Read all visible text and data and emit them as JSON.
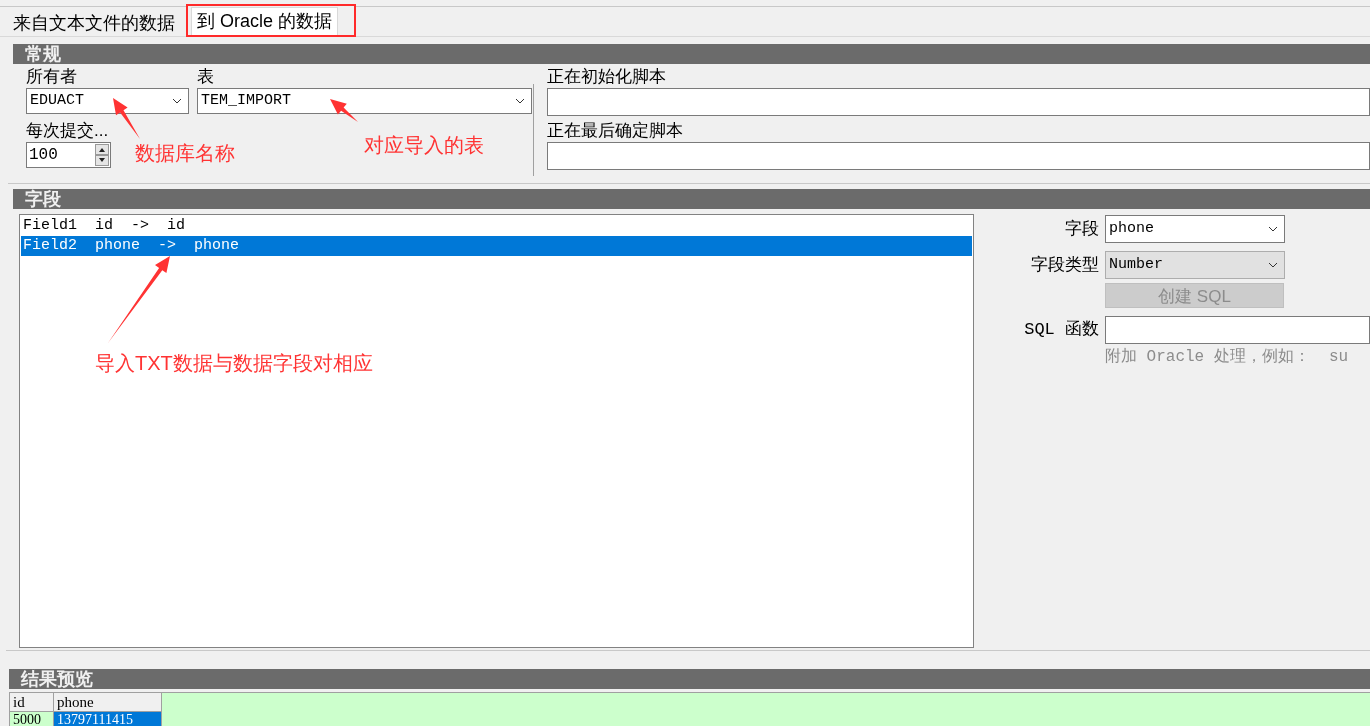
{
  "tabs": [
    {
      "label": "来自文本文件的数据",
      "selected": false
    },
    {
      "label": "到 Oracle 的数据",
      "selected": true
    }
  ],
  "general": {
    "title": "常规",
    "owner": {
      "label": "所有者",
      "value": "EDUACT"
    },
    "table": {
      "label": "表",
      "value": "TEM_IMPORT"
    },
    "commit": {
      "label": "每次提交...",
      "value": "100"
    },
    "init_script": {
      "label": "正在初始化脚本"
    },
    "final_script": {
      "label": "正在最后确定脚本"
    }
  },
  "fields": {
    "title": "字段",
    "mappings": [
      {
        "text": "Field1  id  ->  id",
        "selected": false
      },
      {
        "text": "Field2  phone  ->  phone",
        "selected": true
      }
    ],
    "field": {
      "label": "字段",
      "value": "phone"
    },
    "field_type": {
      "label": "字段类型",
      "value": "Number"
    },
    "create_sql_button": {
      "label": "创建 SQL",
      "disabled": true
    },
    "sql_function": {
      "label": "SQL 函数",
      "hint": "附加 Oracle 处理，例如：  su"
    }
  },
  "preview": {
    "title": "结果预览",
    "columns": [
      "id",
      "phone"
    ],
    "rows": [
      [
        {
          "text": "5000",
          "selected": false
        },
        {
          "text": "13797111415",
          "selected": true
        }
      ]
    ]
  },
  "annotations": [
    {
      "kind": "highlight"
    },
    {
      "kind": "note",
      "text": "数据库名称"
    },
    {
      "kind": "note",
      "text": "对应导入的表"
    },
    {
      "kind": "note",
      "text": "导入TXT数据与数据字段对相应"
    }
  ]
}
